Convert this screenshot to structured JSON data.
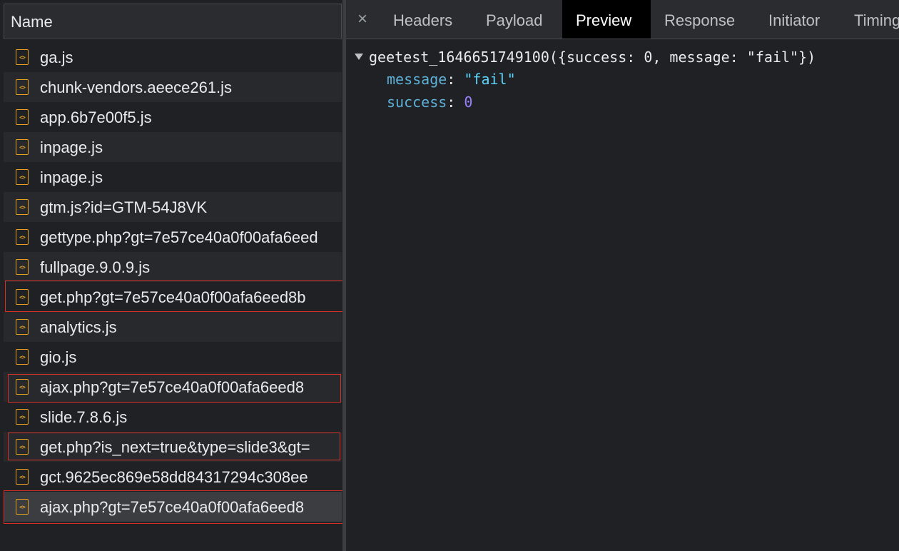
{
  "network_list": {
    "header": "Name",
    "rows": [
      {
        "label": "ga.js"
      },
      {
        "label": "chunk-vendors.aeece261.js"
      },
      {
        "label": "app.6b7e00f5.js"
      },
      {
        "label": "inpage.js"
      },
      {
        "label": "inpage.js"
      },
      {
        "label": "gtm.js?id=GTM-54J8VK"
      },
      {
        "label": "gettype.php?gt=7e57ce40a0f00afa6eed"
      },
      {
        "label": "fullpage.9.0.9.js"
      },
      {
        "label": "get.php?gt=7e57ce40a0f00afa6eed8b"
      },
      {
        "label": "analytics.js"
      },
      {
        "label": "gio.js"
      },
      {
        "label": "ajax.php?gt=7e57ce40a0f00afa6eed8"
      },
      {
        "label": "slide.7.8.6.js"
      },
      {
        "label": "get.php?is_next=true&type=slide3&gt="
      },
      {
        "label": "gct.9625ec869e58dd84317294c308ee"
      },
      {
        "label": "ajax.php?gt=7e57ce40a0f00afa6eed8"
      }
    ]
  },
  "tabs": {
    "close": "×",
    "items": [
      "Headers",
      "Payload",
      "Preview",
      "Response",
      "Initiator",
      "Timing"
    ],
    "active": "Preview"
  },
  "preview": {
    "root": "geetest_1646651749100({success: 0, message: \"fail\"})",
    "properties": [
      {
        "key": "message",
        "sep": ": ",
        "value": "\"fail\"",
        "type": "string"
      },
      {
        "key": "success",
        "sep": ": ",
        "value": "0",
        "type": "number"
      }
    ]
  },
  "colors": {
    "highlight_box": "#d93025",
    "file_icon": "#e5a321"
  }
}
